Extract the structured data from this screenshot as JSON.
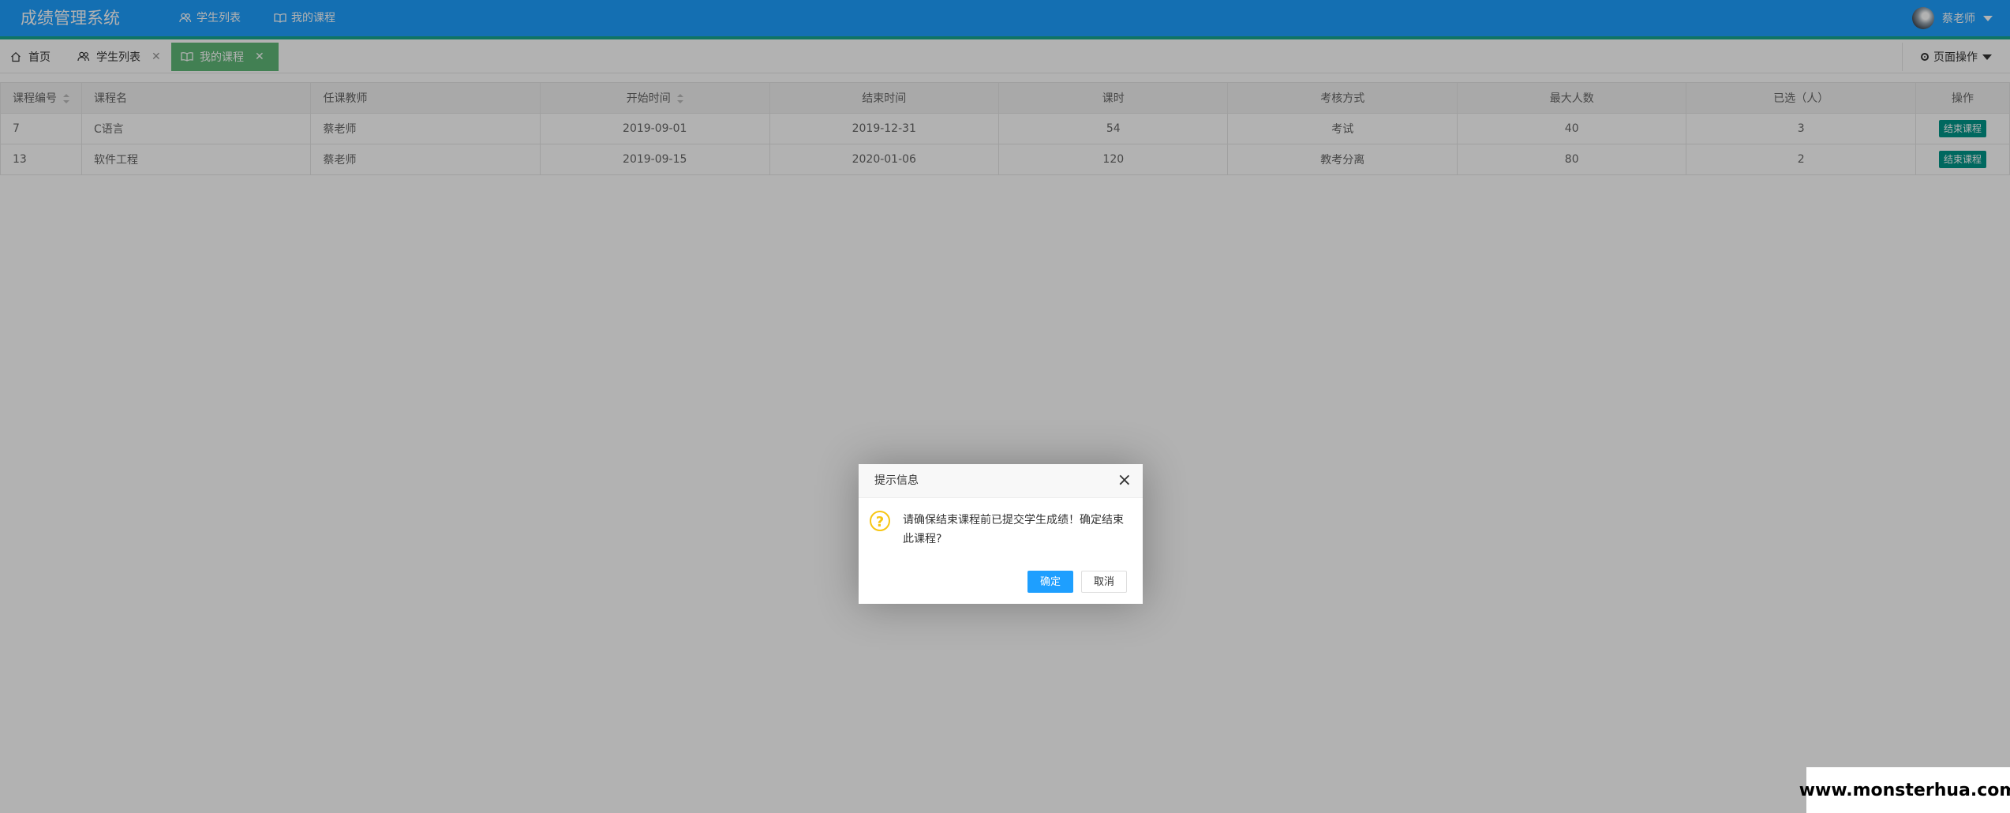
{
  "header": {
    "logo": "成绩管理系统",
    "nav": [
      {
        "label": "学生列表",
        "icon": "users-icon",
        "active": false
      },
      {
        "label": "我的课程",
        "icon": "book-icon",
        "active": true
      }
    ],
    "user": {
      "name": "蔡老师"
    }
  },
  "tabs": {
    "items": [
      {
        "label": "首页",
        "icon": "home-icon",
        "closable": false,
        "active": false
      },
      {
        "label": "学生列表",
        "icon": "users-icon",
        "closable": true,
        "active": false
      },
      {
        "label": "我的课程",
        "icon": "book-icon",
        "closable": true,
        "active": true
      }
    ],
    "page_ops": "页面操作"
  },
  "table": {
    "columns": [
      "课程编号",
      "课程名",
      "任课教师",
      "开始时间",
      "结束时间",
      "课时",
      "考核方式",
      "最大人数",
      "已选（人）",
      "操作"
    ],
    "rows": [
      {
        "id": "7",
        "name": "C语言",
        "teacher": "蔡老师",
        "start": "2019-09-01",
        "end": "2019-12-31",
        "hours": "54",
        "exam": "考试",
        "max": "40",
        "selected": "3",
        "action": "结束课程"
      },
      {
        "id": "13",
        "name": "软件工程",
        "teacher": "蔡老师",
        "start": "2019-09-15",
        "end": "2020-01-06",
        "hours": "120",
        "exam": "教考分离",
        "max": "80",
        "selected": "2",
        "action": "结束课程"
      }
    ]
  },
  "dialog": {
    "title": "提示信息",
    "message_line1": "请确保结束课程前已提交学生成绩！确定结束",
    "message_line2": "此课程?",
    "confirm": "确定",
    "cancel": "取消"
  },
  "watermark": "www.monsterhua.com",
  "colors": {
    "header": "#1e9fff",
    "active_tab": "#5fb878",
    "end_button": "#009688",
    "question_icon": "#f7c613"
  }
}
